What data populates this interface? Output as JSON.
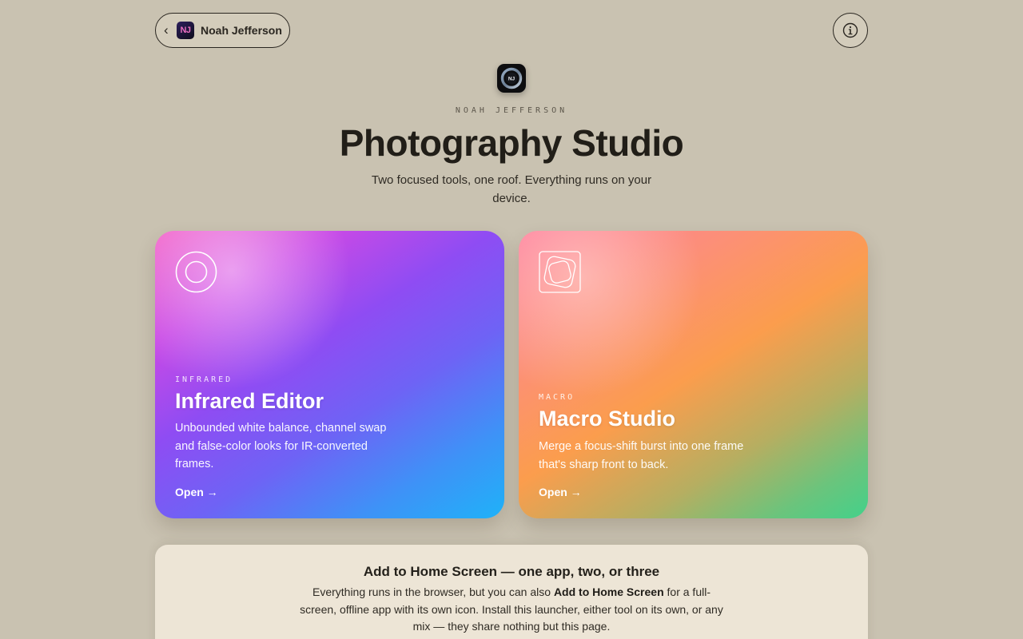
{
  "nav": {
    "back_chevron": "‹",
    "badge_initials": "NJ",
    "back_label": "Noah Jefferson",
    "info_icon": "info-circle-icon"
  },
  "hero": {
    "icon": "lens-aperture-icon",
    "icon_initials": "NJ",
    "eyebrow": "NOAH JEFFERSON",
    "title": "Photography Studio",
    "subtitle": "Two focused tools, one roof. Everything runs on your device."
  },
  "cards": [
    {
      "id": "infrared",
      "icon": "ring-icon",
      "tag": "INFRARED",
      "title": "Infrared Editor",
      "description": "Unbounded white balance, channel swap and false-color looks for IR-converted frames.",
      "action": "Open →",
      "gradient": [
        "#f25fc5",
        "#8f4cf3",
        "#1fb2f8"
      ]
    },
    {
      "id": "macro",
      "icon": "stacked-squares-icon",
      "tag": "MACRO",
      "title": "Macro Studio",
      "description": "Merge a focus-shift burst into one frame that's sharp front to back.",
      "action": "Open →",
      "gradient": [
        "#ff7e9c",
        "#fb9d4d",
        "#43d18a"
      ]
    }
  ],
  "install": {
    "title": "Add to Home Screen — one app, two, or three",
    "body_pre": "Everything runs in the browser, but you can also ",
    "body_bold": "Add to Home Screen",
    "body_post": " for a full-screen, offline app with its own icon. Install this launcher, either tool on its own, or any mix — they share nothing but this page."
  },
  "colors": {
    "background": "#c9c2b1",
    "panel": "#ede5d6",
    "text": "#221f19"
  }
}
